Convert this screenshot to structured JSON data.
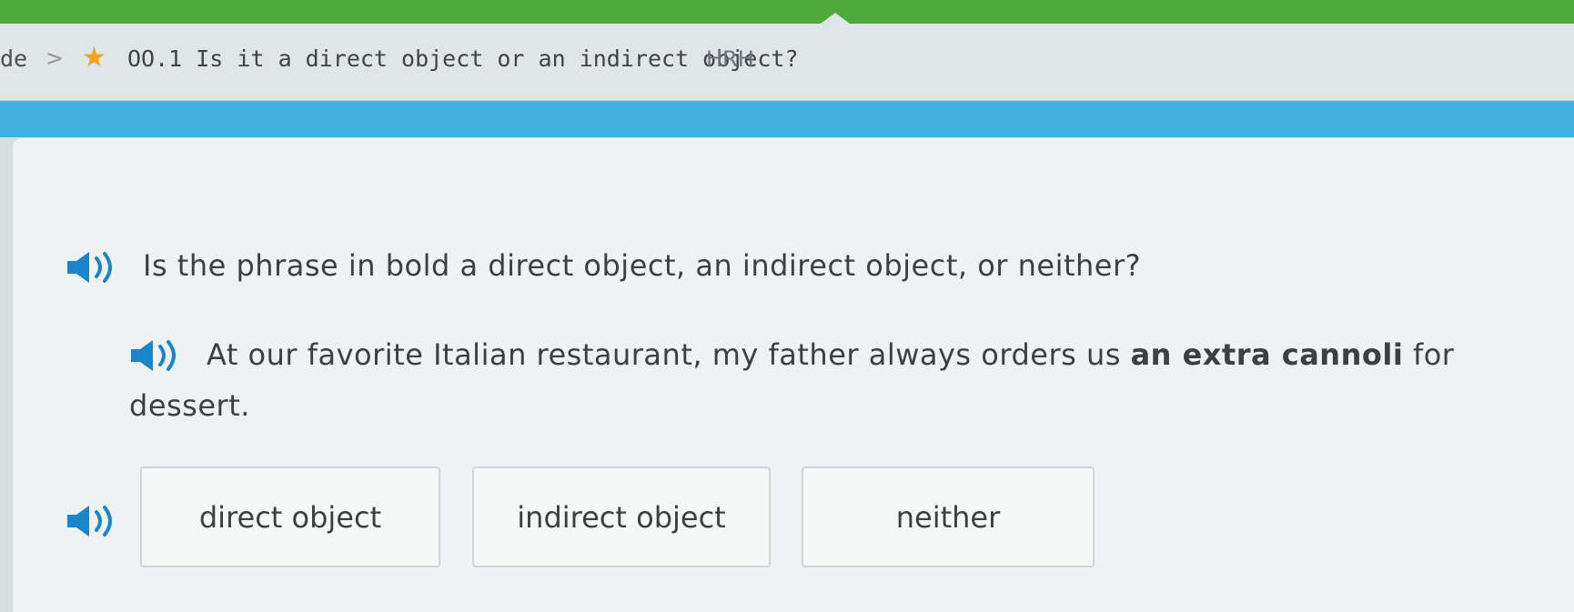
{
  "breadcrumb": {
    "previous": "de",
    "separator": ">",
    "title": "OO.1 Is it a direct object or an indirect object?",
    "code": "HRH"
  },
  "question": {
    "prompt": "Is the phrase in bold a direct object, an indirect object, or neither?",
    "sentence_before": "At our favorite Italian restaurant, my father always orders us ",
    "sentence_bold": "an extra cannoli",
    "sentence_after": " for dessert."
  },
  "choices": [
    "direct object",
    "indirect object",
    "neither"
  ],
  "icons": {
    "speaker": "speaker-icon",
    "star": "star-icon",
    "chevron": "chevron-right-icon"
  },
  "colors": {
    "top_green": "#4fa83a",
    "blue_bar": "#3fb0e0",
    "star": "#f2a31b",
    "speaker": "#1a86c9"
  }
}
